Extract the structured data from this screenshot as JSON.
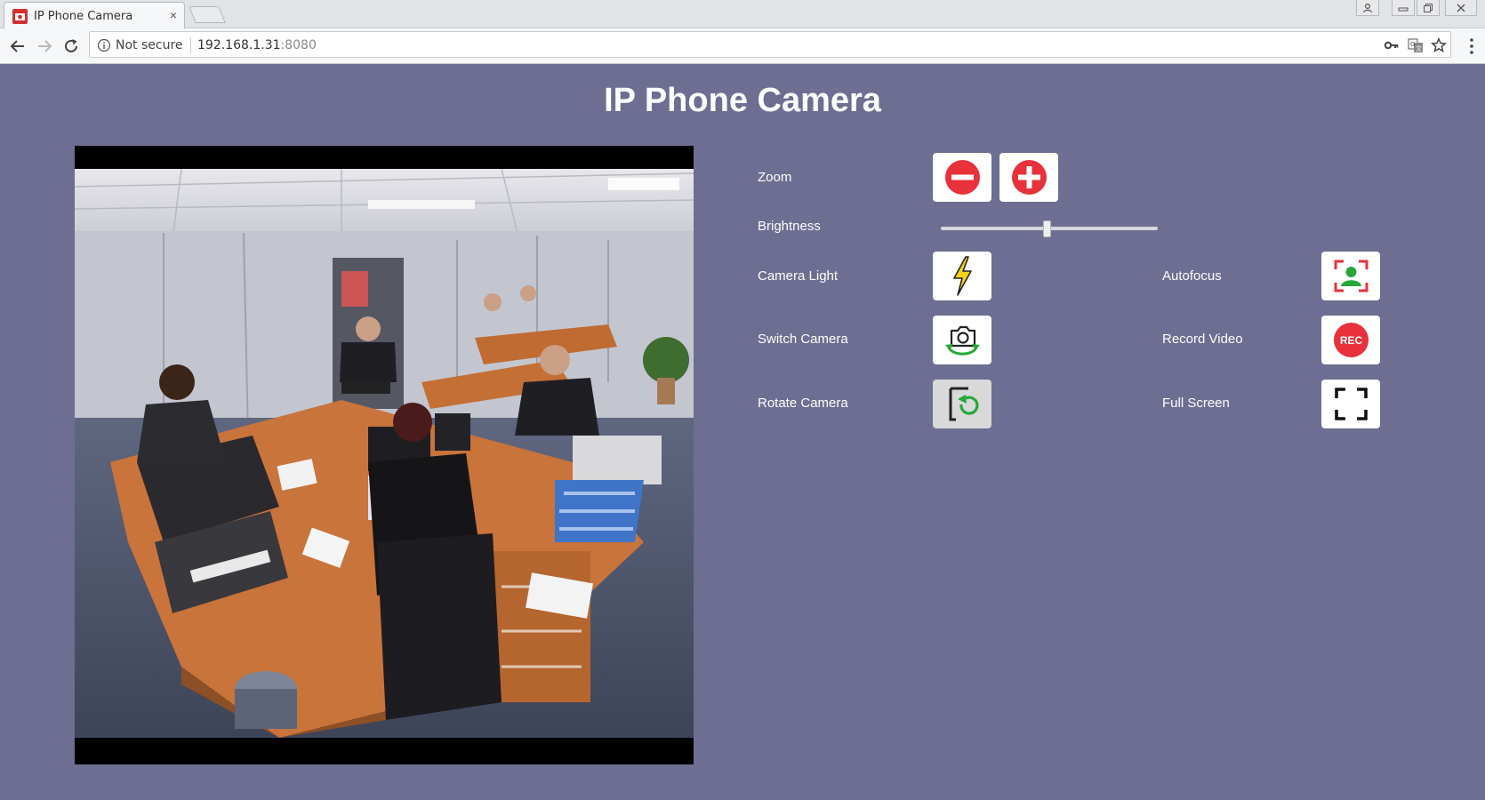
{
  "browser": {
    "tab_title": "IP Phone Camera",
    "tab_close": "×",
    "security_label": "Not secure",
    "url_host": "192.168.1.31",
    "url_port": ":8080"
  },
  "page": {
    "title": "IP Phone Camera",
    "background_color": "#6d6e92"
  },
  "controls": {
    "zoom": {
      "label": "Zoom",
      "out_icon": "minus-circle-icon",
      "in_icon": "plus-circle-icon"
    },
    "brightness": {
      "label": "Brightness",
      "level_fraction": 0.49
    },
    "camera_light": {
      "label": "Camera Light",
      "icon": "lightning-icon"
    },
    "switch_camera": {
      "label": "Switch Camera",
      "icon": "camera-switch-icon"
    },
    "rotate_camera": {
      "label": "Rotate Camera",
      "icon": "rotate-icon"
    },
    "autofocus": {
      "label": "Autofocus",
      "icon": "focus-person-icon"
    },
    "record_video": {
      "label": "Record Video",
      "badge": "REC",
      "icon": "record-icon"
    },
    "full_screen": {
      "label": "Full Screen",
      "icon": "fullscreen-icon"
    }
  },
  "colors": {
    "danger_red": "#e8313a",
    "focus_green": "#26a838",
    "bolt_yellow": "#f6d31b"
  }
}
